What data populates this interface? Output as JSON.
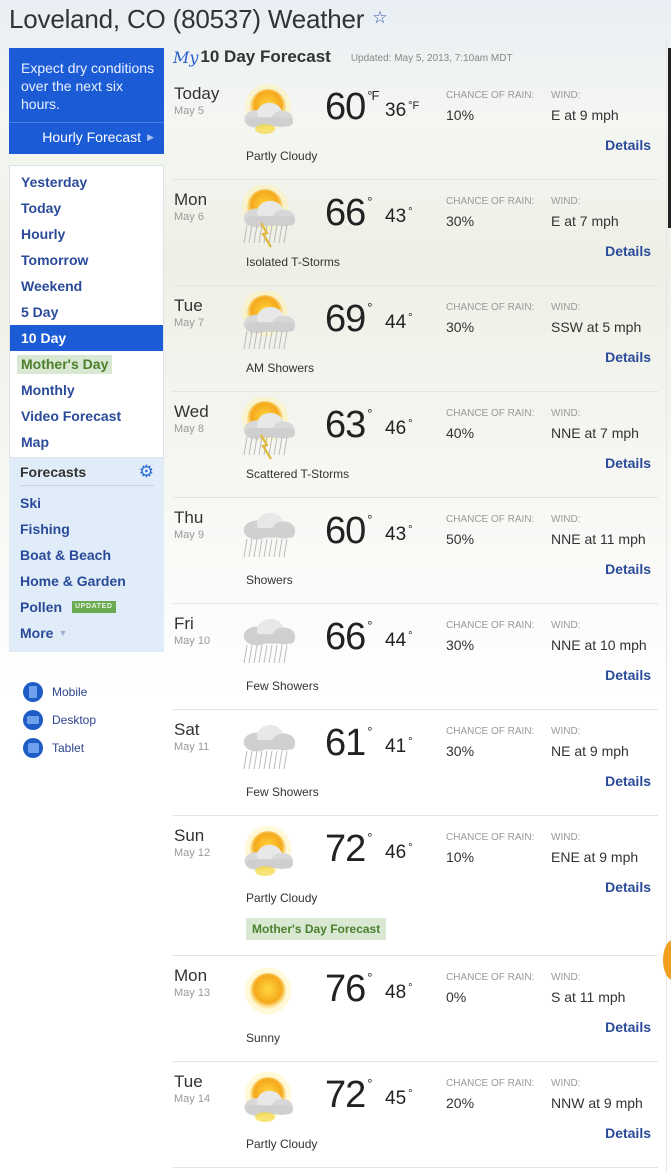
{
  "page": {
    "title": "Loveland, CO (80537) Weather",
    "favorite_icon": "star-outline-icon"
  },
  "sidebar": {
    "promo": {
      "text": "Expect dry conditions over the next six hours.",
      "link_label": "Hourly Forecast"
    },
    "nav": [
      {
        "label": "Yesterday",
        "active": false
      },
      {
        "label": "Today",
        "active": false
      },
      {
        "label": "Hourly",
        "active": false
      },
      {
        "label": "Tomorrow",
        "active": false
      },
      {
        "label": "Weekend",
        "active": false
      },
      {
        "label": "5 Day",
        "active": false
      },
      {
        "label": "10 Day",
        "active": true
      },
      {
        "label": "Mother's Day",
        "active": false,
        "special": true
      },
      {
        "label": "Monthly",
        "active": false
      },
      {
        "label": "Video Forecast",
        "active": false
      },
      {
        "label": "Map",
        "active": false
      }
    ],
    "forecasts": {
      "title": "Forecasts",
      "items": [
        "Ski",
        "Fishing",
        "Boat & Beach",
        "Home & Garden",
        "Pollen",
        "More"
      ],
      "pollen_badge": "UPDATED"
    },
    "devices": [
      "Mobile",
      "Desktop",
      "Tablet"
    ]
  },
  "main": {
    "logo": "My",
    "title": "10 Day Forecast",
    "updated": "Updated: May 5, 2013, 7:10am MDT",
    "rain_label": "CHANCE OF RAIN:",
    "wind_label": "WIND:",
    "details_label": "Details",
    "mothers_day_button": "Mother's Day Forecast",
    "days": [
      {
        "day": "Today",
        "date": "May 5",
        "icon": "partly-cloudy",
        "condition": "Partly Cloudy",
        "hi": "60",
        "lo": "36",
        "unit": "°F",
        "rain": "10%",
        "wind": "E at 9 mph"
      },
      {
        "day": "Mon",
        "date": "May 6",
        "icon": "isolated-tstorms",
        "condition": "Isolated T-Storms",
        "hi": "66",
        "lo": "43",
        "unit": "°",
        "rain": "30%",
        "wind": "E at 7 mph"
      },
      {
        "day": "Tue",
        "date": "May 7",
        "icon": "am-showers",
        "condition": "AM Showers",
        "hi": "69",
        "lo": "44",
        "unit": "°",
        "rain": "30%",
        "wind": "SSW at 5 mph"
      },
      {
        "day": "Wed",
        "date": "May 8",
        "icon": "scattered-tstorms",
        "condition": "Scattered T-Storms",
        "hi": "63",
        "lo": "46",
        "unit": "°",
        "rain": "40%",
        "wind": "NNE at 7 mph"
      },
      {
        "day": "Thu",
        "date": "May 9",
        "icon": "showers",
        "condition": "Showers",
        "hi": "60",
        "lo": "43",
        "unit": "°",
        "rain": "50%",
        "wind": "NNE at 11 mph"
      },
      {
        "day": "Fri",
        "date": "May 10",
        "icon": "showers",
        "condition": "Few Showers",
        "hi": "66",
        "lo": "44",
        "unit": "°",
        "rain": "30%",
        "wind": "NNE at 10 mph"
      },
      {
        "day": "Sat",
        "date": "May 11",
        "icon": "showers",
        "condition": "Few Showers",
        "hi": "61",
        "lo": "41",
        "unit": "°",
        "rain": "30%",
        "wind": "NE at 9 mph"
      },
      {
        "day": "Sun",
        "date": "May 12",
        "icon": "partly-cloudy",
        "condition": "Partly Cloudy",
        "hi": "72",
        "lo": "46",
        "unit": "°",
        "rain": "10%",
        "wind": "ENE at 9 mph",
        "mothers_day": true
      },
      {
        "day": "Mon",
        "date": "May 13",
        "icon": "sunny",
        "condition": "Sunny",
        "hi": "76",
        "lo": "48",
        "unit": "°",
        "rain": "0%",
        "wind": "S at 11 mph"
      },
      {
        "day": "Tue",
        "date": "May 14",
        "icon": "partly-cloudy",
        "condition": "Partly Cloudy",
        "hi": "72",
        "lo": "45",
        "unit": "°",
        "rain": "20%",
        "wind": "NNW at 9 mph"
      }
    ]
  },
  "colors": {
    "brand_blue": "#1b5bd6",
    "link_blue": "#2a4a9a",
    "mothers_day_bg": "#d9e8d3",
    "mothers_day_text": "#4b7f2c",
    "updated_badge": "#6aaa50"
  }
}
